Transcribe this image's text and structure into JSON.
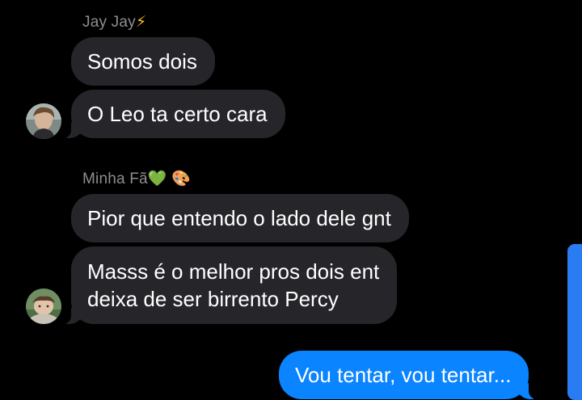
{
  "conversation": {
    "group1": {
      "sender": "Jay Jay",
      "sender_emoji": "⚡",
      "messages": [
        "Somos dois",
        "O Leo ta certo cara"
      ]
    },
    "group2": {
      "sender": "Minha Fã",
      "sender_emoji": "💚",
      "sender_emoji2": "🎨",
      "messages": [
        "Pior que entendo o lado dele gnt",
        [
          "Masss é o melhor pros dois ent",
          "deixa de ser birrento Percy"
        ]
      ]
    },
    "outgoing": {
      "messages": [
        "Vou tentar, vou tentar..."
      ]
    }
  },
  "colors": {
    "background": "#000000",
    "incoming_bubble": "#26252a",
    "outgoing_bubble": "#0a84ff",
    "sender_name": "#8e8e93",
    "scrollbar": "#2a7cf2"
  },
  "icons": {
    "avatar1": "avatar-photo-jay-jay",
    "avatar2": "avatar-photo-minha-fa"
  }
}
